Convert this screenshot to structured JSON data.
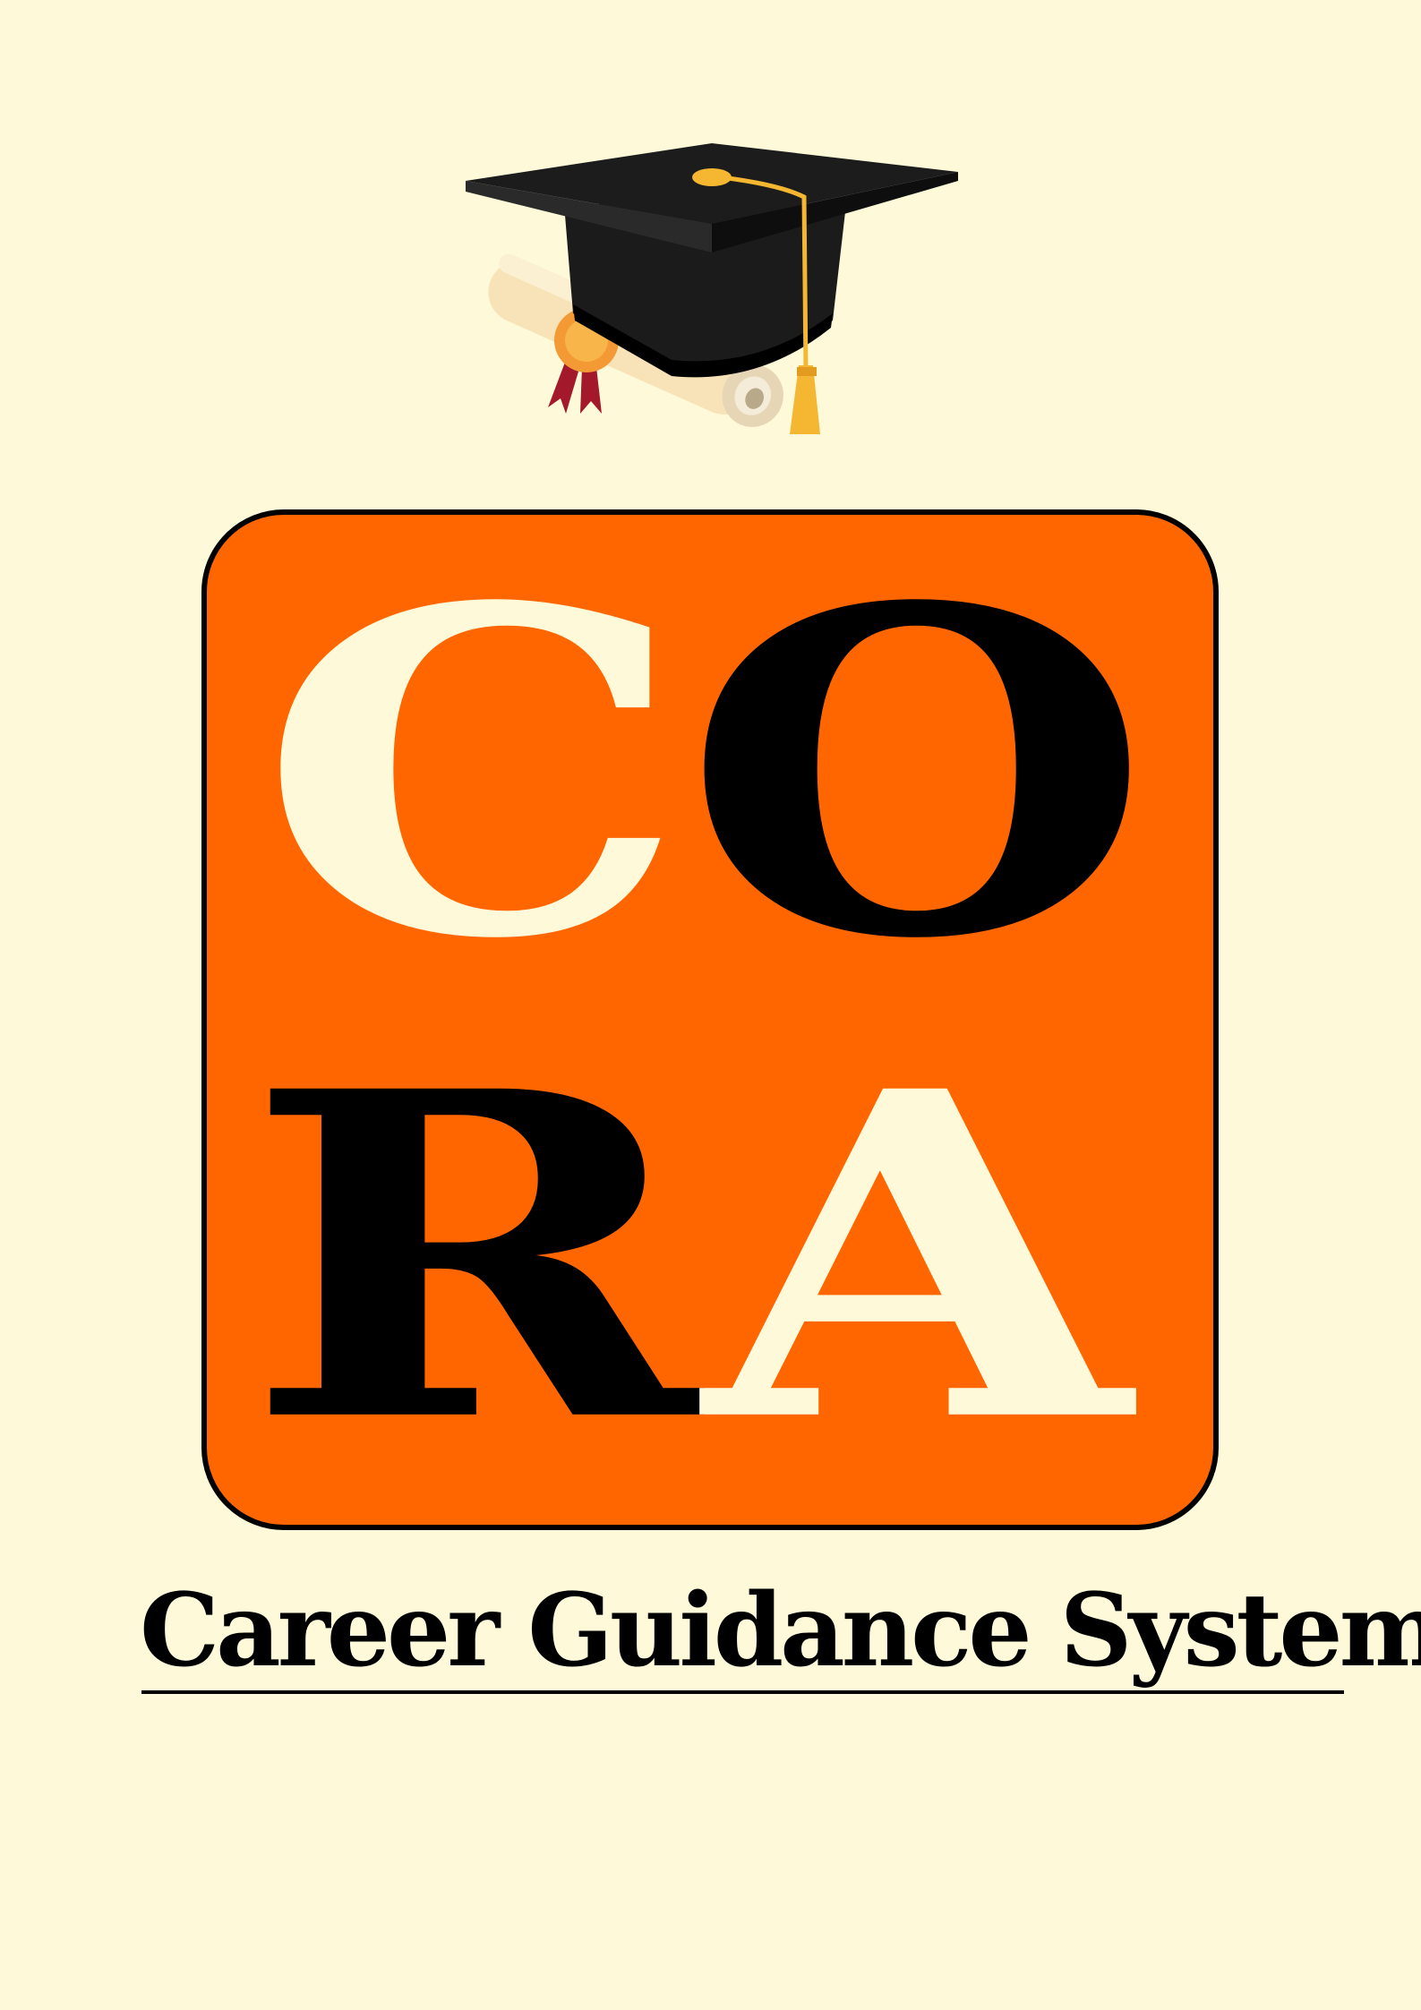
{
  "logo": {
    "letters": [
      "C",
      "O",
      "R",
      "A"
    ]
  },
  "subtitle": "Career Guidance System",
  "icons": {
    "graduation": "graduation-cap-icon",
    "diploma": "diploma-scroll-icon"
  },
  "colors": {
    "background": "#FEFAD9",
    "logo_fill": "#FF6600",
    "logo_border": "#000000",
    "cream_letter": "#FEFAD9",
    "dark_letter": "#000000",
    "tassel": "#F5B731",
    "seal": "#F4A03A",
    "ribbon": "#A3192B"
  }
}
